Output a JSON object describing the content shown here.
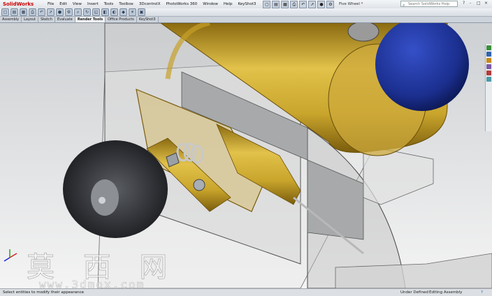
{
  "app": {
    "logo_text": "SolidWorks",
    "doc_title": "Five Wheel *"
  },
  "menu": [
    "File",
    "Edit",
    "View",
    "Insert",
    "Tools",
    "Toolbox",
    "3DcontrolX",
    "PhotoWorks 360",
    "Window",
    "Help",
    "KeyShot3"
  ],
  "search": {
    "placeholder": "Search SolidWorks Help"
  },
  "window_controls": [
    "?",
    "-",
    "□",
    "×"
  ],
  "toolbar": {
    "icons": [
      "new-icon",
      "open-icon",
      "save-icon",
      "print-icon",
      "undo-icon",
      "select-icon",
      "rebuild-icon",
      "options-icon",
      "zoom-icon",
      "rotate-icon",
      "view-orient-icon",
      "display-style-icon",
      "hide-show-icon",
      "appearance-icon",
      "scene-icon",
      "view-settings-icon"
    ]
  },
  "tabs": [
    {
      "label": "Assembly"
    },
    {
      "label": "Layout"
    },
    {
      "label": "Sketch"
    },
    {
      "label": "Evaluate"
    },
    {
      "label": "Render Tools",
      "active": true
    },
    {
      "label": "Office Products"
    },
    {
      "label": "KeyShot3"
    }
  ],
  "status": {
    "left": "Select entities to modify their appearance",
    "defined": "Under Defined",
    "mode": "Editing Assembly",
    "help": "?"
  },
  "watermark": {
    "chinese": "莫 西 网",
    "url": "www.3dmox.com"
  },
  "colors": {
    "brass": "#c9a52c",
    "blue_ball": "#1b2f8f",
    "wheel": "#2f3136",
    "background": "#d8d8d8"
  }
}
